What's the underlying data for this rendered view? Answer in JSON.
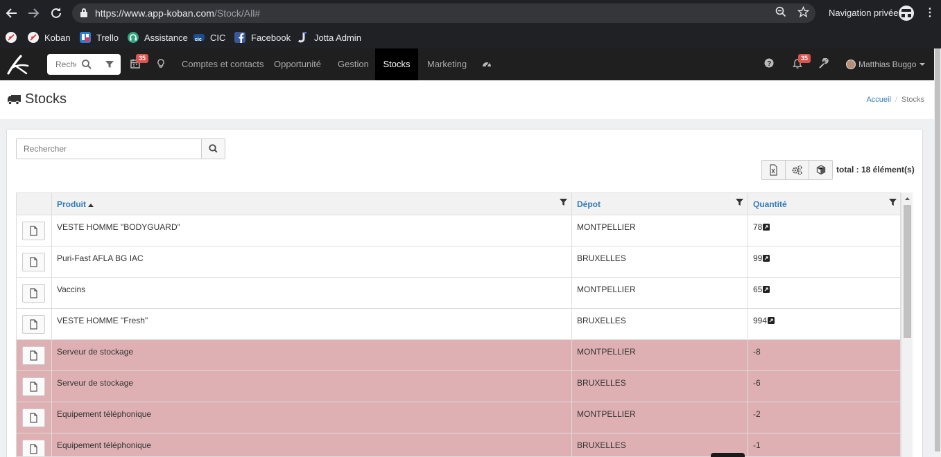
{
  "browser": {
    "url_host": "https://www.app-koban.com",
    "url_path": "/Stock/All#",
    "incognito_label": "Navigation privée",
    "bookmarks": [
      {
        "label": "",
        "icon": "koban-icon"
      },
      {
        "label": "Koban",
        "icon": "koban-icon"
      },
      {
        "label": "Trello",
        "icon": "trello-icon"
      },
      {
        "label": "Assistance",
        "icon": "headset-icon"
      },
      {
        "label": "CIC",
        "icon": "cic-icon"
      },
      {
        "label": "Facebook",
        "icon": "facebook-icon"
      },
      {
        "label": "Jotta Admin",
        "icon": "jotta-icon"
      }
    ]
  },
  "nav": {
    "search_placeholder": "Rechercher",
    "calendar_badge": "35",
    "notifications_badge": "35",
    "links": [
      "Comptes et contacts",
      "Opportunité",
      "Gestion",
      "Stocks",
      "Marketing"
    ],
    "active_link": "Stocks",
    "user_name": "Matthias Buggo"
  },
  "page": {
    "title": "Stocks",
    "breadcrumb_home": "Accueil",
    "breadcrumb_current": "Stocks"
  },
  "list": {
    "search_placeholder": "Rechercher",
    "total_label": "total : 18 élément(s)",
    "columns": [
      "Produit",
      "Dépot",
      "Quantité"
    ],
    "sorted_column": "Produit",
    "rows": [
      {
        "produit": "VESTE HOMME \"BODYGUARD\"",
        "depot": "MONTPELLIER",
        "quantite": "78",
        "negative": false,
        "has_link": true
      },
      {
        "produit": "Puri-Fast AFLA BG IAC",
        "depot": "BRUXELLES",
        "quantite": "99",
        "negative": false,
        "has_link": true
      },
      {
        "produit": "Vaccins",
        "depot": "MONTPELLIER",
        "quantite": "65",
        "negative": false,
        "has_link": true
      },
      {
        "produit": "VESTE HOMME \"Fresh\"",
        "depot": "BRUXELLES",
        "quantite": "994",
        "negative": false,
        "has_link": true
      },
      {
        "produit": "Serveur de stockage",
        "depot": "MONTPELLIER",
        "quantite": "-8",
        "negative": true,
        "has_link": false
      },
      {
        "produit": "Serveur de stockage",
        "depot": "BRUXELLES",
        "quantite": "-6",
        "negative": true,
        "has_link": false
      },
      {
        "produit": "Equipement téléphonique",
        "depot": "MONTPELLIER",
        "quantite": "-2",
        "negative": true,
        "has_link": false
      },
      {
        "produit": "Equipement téléphonique",
        "depot": "BRUXELLES",
        "quantite": "-1",
        "negative": true,
        "has_link": false
      }
    ]
  },
  "colors": {
    "navbar": "#1f1f1f",
    "link": "#337ab7",
    "negative_row": "#deb0b3",
    "badge": "#d9534f"
  }
}
